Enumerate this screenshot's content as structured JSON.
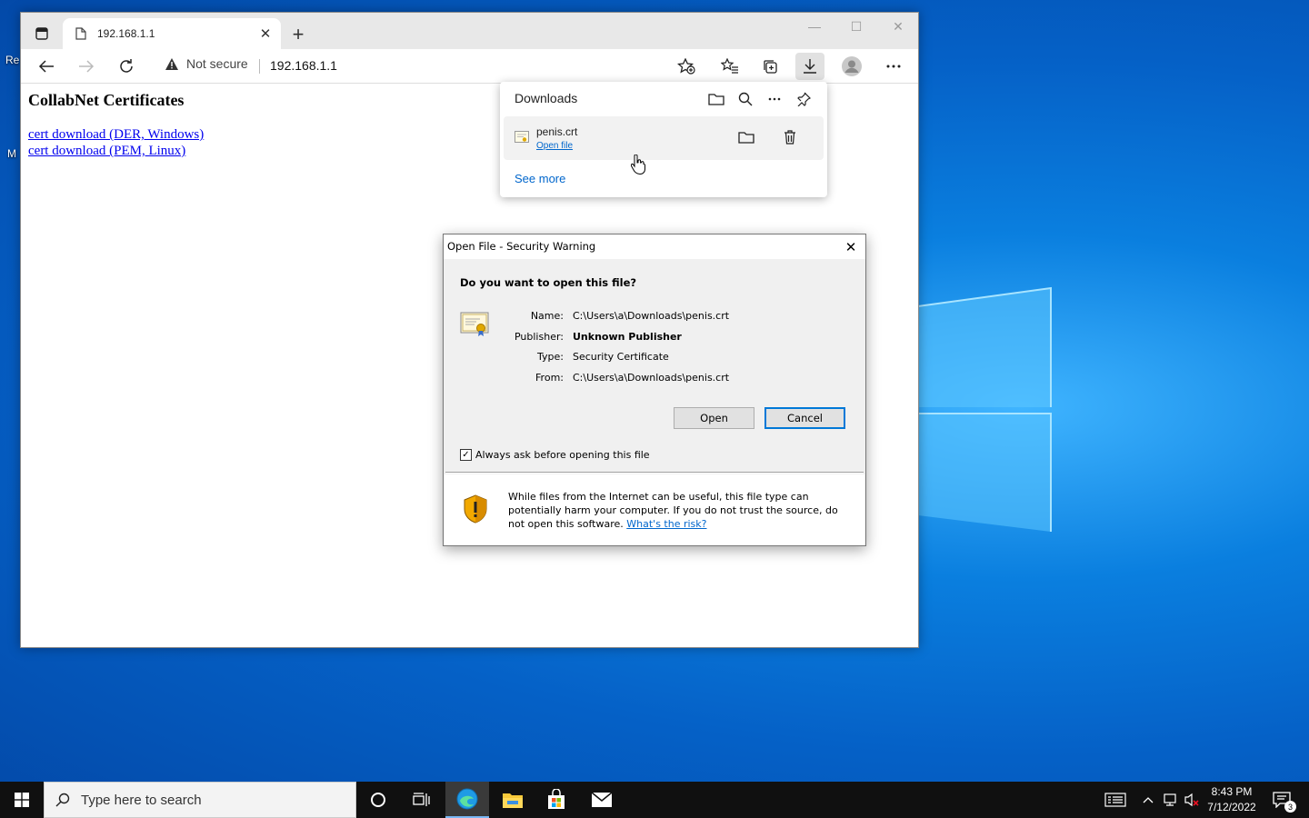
{
  "desktop": {
    "fragment_top": "Re",
    "fragment_mid": "M"
  },
  "browser": {
    "tab": {
      "title": "192.168.1.1",
      "close": "✕"
    },
    "new_tab": "+",
    "window_controls": {
      "minimize": "—",
      "maximize": "☐",
      "close": "✕"
    },
    "address_bar": {
      "security_text": "Not secure",
      "url": "192.168.1.1"
    }
  },
  "page": {
    "heading": "CollabNet Certificates",
    "links": [
      "cert download (DER, Windows)",
      "cert download (PEM, Linux)"
    ]
  },
  "downloads_panel": {
    "title": "Downloads",
    "item": {
      "filename": "penis.crt",
      "action": "Open file"
    },
    "see_more": "See more"
  },
  "dialog": {
    "title": "Open File - Security Warning",
    "close": "✕",
    "question": "Do you want to open this file?",
    "fields": [
      {
        "label": "Name:",
        "value": "C:\\Users\\a\\Downloads\\penis.crt",
        "bold": false
      },
      {
        "label": "Publisher:",
        "value": "Unknown Publisher",
        "bold": true
      },
      {
        "label": "Type:",
        "value": "Security Certificate",
        "bold": false
      },
      {
        "label": "From:",
        "value": "C:\\Users\\a\\Downloads\\penis.crt",
        "bold": false
      }
    ],
    "open_button": "Open",
    "cancel_button": "Cancel",
    "checkbox_label": "Always ask before opening this file",
    "checkbox_checked": true,
    "warning_text": "While files from the Internet can be useful, this file type can potentially harm your computer. If you do not trust the source, do not open this software.",
    "risk_link": "What's the risk?"
  },
  "taskbar": {
    "search_placeholder": "Type here to search",
    "clock_time": "8:43 PM",
    "clock_date": "7/12/2022",
    "notification_count": "3"
  },
  "colors": {
    "accent": "#0078d7",
    "link": "#0066cc",
    "desktop_blue": "#0a7fdf",
    "taskbar": "#101010"
  }
}
